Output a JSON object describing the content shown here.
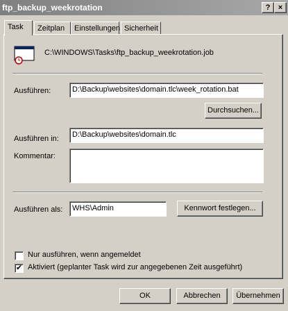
{
  "window": {
    "title": "ftp_backup_weekrotation",
    "help_button": "?",
    "close_button": "×"
  },
  "tabs": [
    {
      "label": "Task",
      "active": true
    },
    {
      "label": "Zeitplan"
    },
    {
      "label": "Einstellungen"
    },
    {
      "label": "Sicherheit"
    }
  ],
  "task": {
    "job_path": "C:\\WINDOWS\\Tasks\\ftp_backup_weekrotation.job",
    "run_label": "Ausführen:",
    "run_value": "D:\\Backup\\websites\\domain.tlc\\week_rotation.bat",
    "browse_label": "Durchsuchen...",
    "start_in_label": "Ausführen in:",
    "start_in_value": "D:\\Backup\\websites\\domain.tlc",
    "comment_label": "Kommentar:",
    "comment_value": "",
    "run_as_label": "Ausführen als:",
    "run_as_value": "WHS\\Admin",
    "set_password_label": "Kennwort festlegen...",
    "only_logged_on_label": "Nur ausführen, wenn angemeldet",
    "only_logged_on_checked": false,
    "enabled_label": "Aktiviert (geplanter Task wird zur angegebenen Zeit ausgeführt)",
    "enabled_checked": true
  },
  "footer": {
    "ok_label": "OK",
    "cancel_label": "Abbrechen",
    "apply_label": "Übernehmen"
  },
  "icons": {
    "task_icon": "scheduled-task-window-icon",
    "checkmark": "✔"
  }
}
